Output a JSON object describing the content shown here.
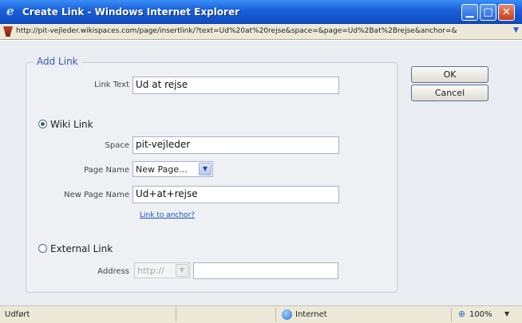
{
  "window": {
    "title": "Create Link - Windows Internet Explorer",
    "minimize_icon": "minimize-icon",
    "maximize_icon": "maximize-icon",
    "close_icon": "close-icon"
  },
  "address_bar": {
    "url": "http://pit-vejleder.wikispaces.com/page/insertlink/?text=Ud%20at%20rejse&space=&page=Ud%2Bat%2Brejse&anchor=&"
  },
  "form": {
    "group_label": "Add Link",
    "link_text_label": "Link Text",
    "link_text_value": "Ud at rejse",
    "wiki_link_label": "Wiki Link",
    "wiki_link_selected": true,
    "space_label": "Space",
    "space_value": "pit-vejleder",
    "page_name_label": "Page Name",
    "page_name_value": "New Page...",
    "new_page_name_label": "New Page Name",
    "new_page_name_value": "Ud+at+rejse",
    "link_to_anchor": "Link to anchor?",
    "external_link_label": "External Link",
    "external_link_selected": false,
    "address_label": "Address",
    "address_protocol": "http://",
    "address_value": ""
  },
  "buttons": {
    "ok": "OK",
    "cancel": "Cancel"
  },
  "status_bar": {
    "status": "Udført",
    "zone": "Internet",
    "zoom": "100%"
  },
  "colors": {
    "titlebar": "#1a5fd8",
    "link": "#1c4ecb",
    "legend": "#3a5fa8"
  }
}
